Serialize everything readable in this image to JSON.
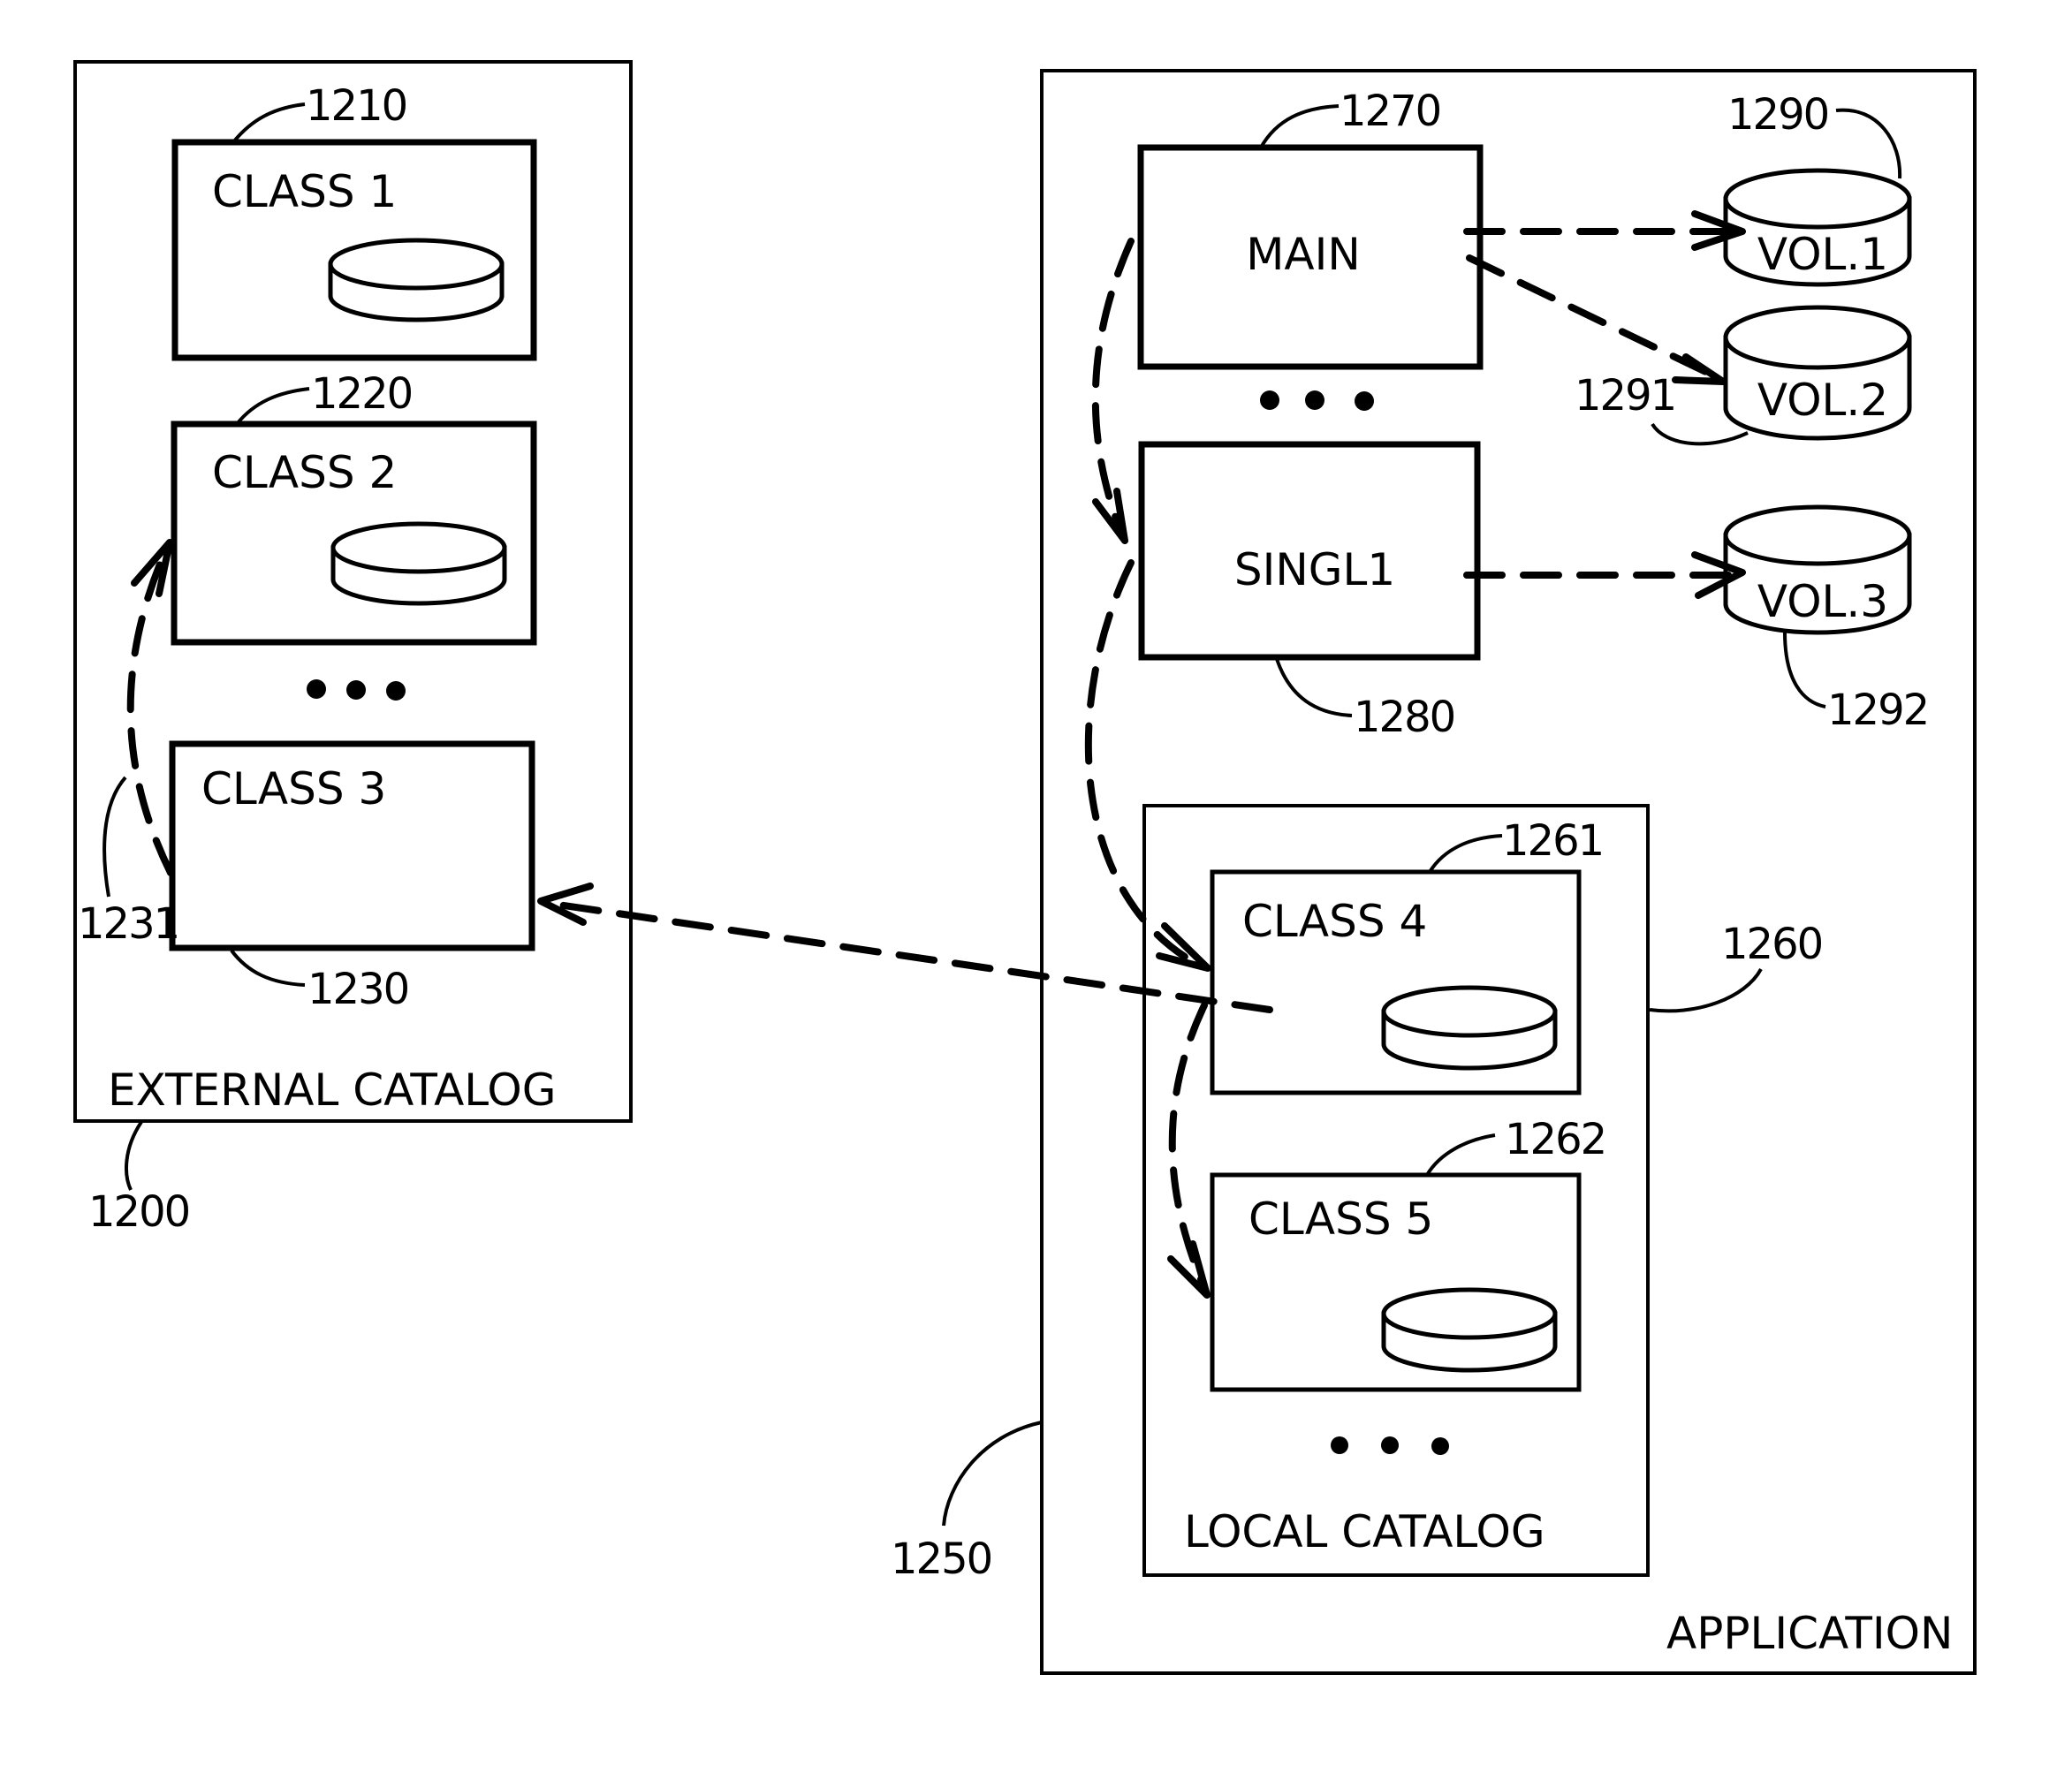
{
  "figure": {
    "external_catalog": {
      "label": "EXTERNAL CATALOG",
      "ref": "1200",
      "classes": [
        {
          "label": "CLASS 1",
          "ref": "1210",
          "has_disk": true
        },
        {
          "label": "CLASS 2",
          "ref": "1220",
          "has_disk": true
        },
        {
          "label": "CLASS 3",
          "ref": "1230",
          "has_disk": false
        }
      ],
      "ellipsis": "• • •",
      "link_ref": "1231"
    },
    "application": {
      "label": "APPLICATION",
      "ref": "1250",
      "modules": [
        {
          "label": "MAIN",
          "ref": "1270"
        },
        {
          "label": "SINGL1",
          "ref": "1280"
        }
      ],
      "volumes": [
        {
          "label": "VOL.1",
          "ref": "1290"
        },
        {
          "label": "VOL.2",
          "ref": "1291"
        },
        {
          "label": "VOL.3",
          "ref": "1292"
        }
      ],
      "local_catalog": {
        "label": "LOCAL CATALOG",
        "ref": "1260",
        "classes": [
          {
            "label": "CLASS 4",
            "ref": "1261",
            "has_disk": true
          },
          {
            "label": "CLASS 5",
            "ref": "1262",
            "has_disk": true
          }
        ]
      }
    },
    "connections": [
      {
        "from": "MAIN",
        "to": "VOL.1",
        "style": "dashed-arrow"
      },
      {
        "from": "MAIN",
        "to": "VOL.2",
        "style": "dashed-arrow"
      },
      {
        "from": "SINGL1",
        "to": "VOL.3",
        "style": "dashed-arrow"
      },
      {
        "from": "MAIN",
        "to": "SINGL1",
        "style": "dashed-curved-arrow"
      },
      {
        "from": "SINGL1",
        "to": "CLASS 4",
        "style": "dashed-curved-arrow"
      },
      {
        "from": "CLASS 4",
        "to": "CLASS 5",
        "style": "dashed-curved-arrow"
      },
      {
        "from": "CLASS 4",
        "to": "CLASS 3",
        "style": "dashed-arrow"
      },
      {
        "from": "CLASS 3",
        "to": "CLASS 2",
        "style": "dashed-curved-arrow",
        "ref": "1231"
      }
    ],
    "colors": {
      "ink": "#000000",
      "paper": "#ffffff"
    }
  }
}
